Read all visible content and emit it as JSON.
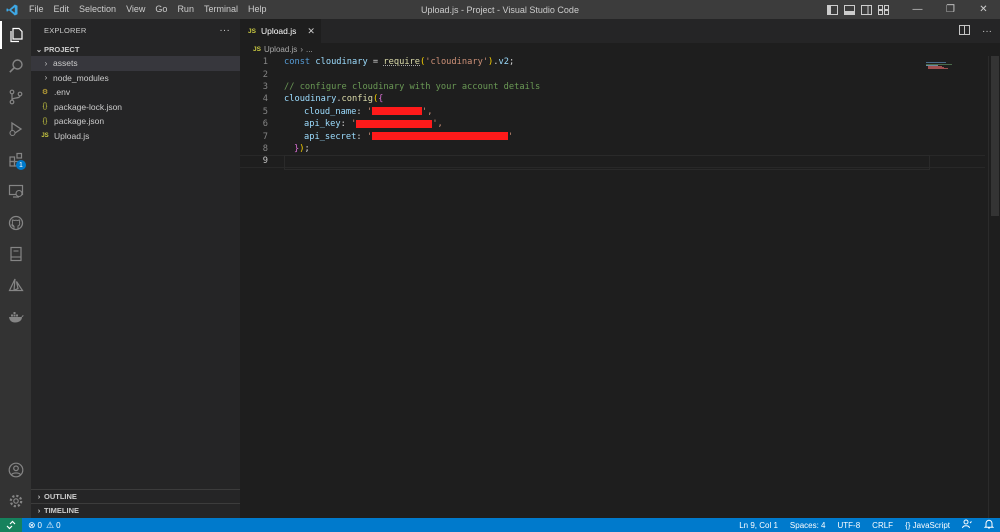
{
  "window": {
    "title": "Upload.js - Project - Visual Studio Code",
    "menu": [
      "File",
      "Edit",
      "Selection",
      "View",
      "Go",
      "Run",
      "Terminal",
      "Help"
    ],
    "controls": {
      "minimize": "—",
      "restore": "❐",
      "close": "✕"
    }
  },
  "activity_bar": {
    "items": [
      "explorer-icon",
      "search-icon",
      "source-control-icon",
      "run-debug-icon",
      "extensions-icon",
      "remote-explorer-icon",
      "github-icon",
      "notebook-icon",
      "azure-icon",
      "docker-icon"
    ],
    "extensions_badge": "1",
    "bottom": [
      "accounts-icon",
      "manage-gear-icon"
    ]
  },
  "sidebar": {
    "header": "EXPLORER",
    "more": "···",
    "section": "PROJECT",
    "files": [
      {
        "name": "assets",
        "type": "folder",
        "icon": "›"
      },
      {
        "name": "node_modules",
        "type": "folder",
        "icon": "›"
      },
      {
        "name": ".env",
        "type": "env",
        "icon": "⚙"
      },
      {
        "name": "package-lock.json",
        "type": "json",
        "icon": "{}"
      },
      {
        "name": "package.json",
        "type": "json",
        "icon": "{}"
      },
      {
        "name": "Upload.js",
        "type": "js",
        "icon": "JS"
      }
    ],
    "outline": "OUTLINE",
    "timeline": "TIMELINE"
  },
  "editor": {
    "tab_label": "Upload.js",
    "tab_icon": "JS",
    "breadcrumb": {
      "file": "Upload.js",
      "sep": "›",
      "rest": "..."
    },
    "line_numbers": [
      "1",
      "2",
      "3",
      "4",
      "5",
      "6",
      "7",
      "8",
      "9"
    ],
    "code": {
      "l1": {
        "kw": "const",
        "var": "cloudinary",
        "eq": " = ",
        "fn": "require",
        "open": "(",
        "str": "'cloudinary'",
        "close": ")",
        "dot": ".",
        "prop": "v2",
        "semi": ";"
      },
      "l3": {
        "comment": "// configure cloudinary with your account details"
      },
      "l4": {
        "obj": "cloudinary",
        "dot": ".",
        "fn": "config",
        "paren": "(",
        "brace": "{"
      },
      "l5": {
        "key": "cloud_name",
        "colon": ": ",
        "quote": "'",
        "comma": "',"
      },
      "l6": {
        "key": "api_key",
        "colon": ": ",
        "quote": "'",
        "comma": "',"
      },
      "l7": {
        "key": "api_secret",
        "colon": ": ",
        "quote": "'",
        "comma": "'"
      },
      "l8": {
        "brace": "}",
        "paren": ")",
        "semi": ";"
      }
    }
  },
  "status_bar": {
    "errors": "0",
    "warnings": "0",
    "position": "Ln 9, Col 1",
    "spaces": "Spaces: 4",
    "encoding": "UTF-8",
    "eol": "CRLF",
    "language": "JavaScript",
    "colors": {
      "bar": "#007acc",
      "remote": "#16825d"
    }
  }
}
